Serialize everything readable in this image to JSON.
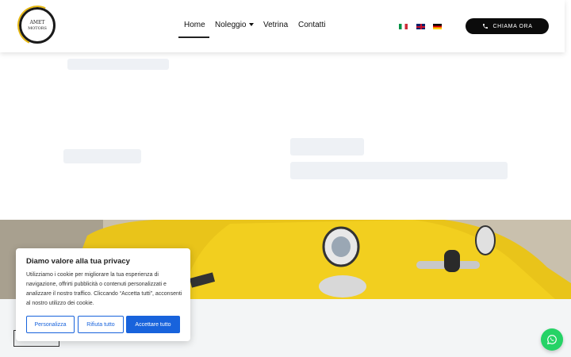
{
  "brand": {
    "logo_line1": "AMET",
    "logo_line2": "MOTORS"
  },
  "nav": {
    "home": "Home",
    "noleggio": "Noleggio",
    "vetrina": "Vetrina",
    "contatti": "Contatti"
  },
  "languages": [
    {
      "code": "it",
      "icon": "flag-italy-icon"
    },
    {
      "code": "en",
      "icon": "flag-uk-icon"
    },
    {
      "code": "de",
      "icon": "flag-germany-icon"
    }
  ],
  "call_button": {
    "label": "CHIAMA ORA",
    "icon": "phone-icon"
  },
  "cookie_banner": {
    "title": "Diamo valore alla tua privacy",
    "text": "Utilizziamo i cookie per migliorare la tua esperienza di navigazione, offrirti pubblicità o contenuti personalizzati e analizzare il nostro traffico. Cliccando “Accetta tutti”, acconsenti al nostro utilizzo dei cookie.",
    "customize_label": "Personalizza",
    "reject_label": "Rifiuta tutto",
    "accept_label": "Accettare tutto"
  },
  "colors": {
    "accent": "#1863dc",
    "header_button": "#0b0b0b",
    "whatsapp": "#25d366"
  }
}
